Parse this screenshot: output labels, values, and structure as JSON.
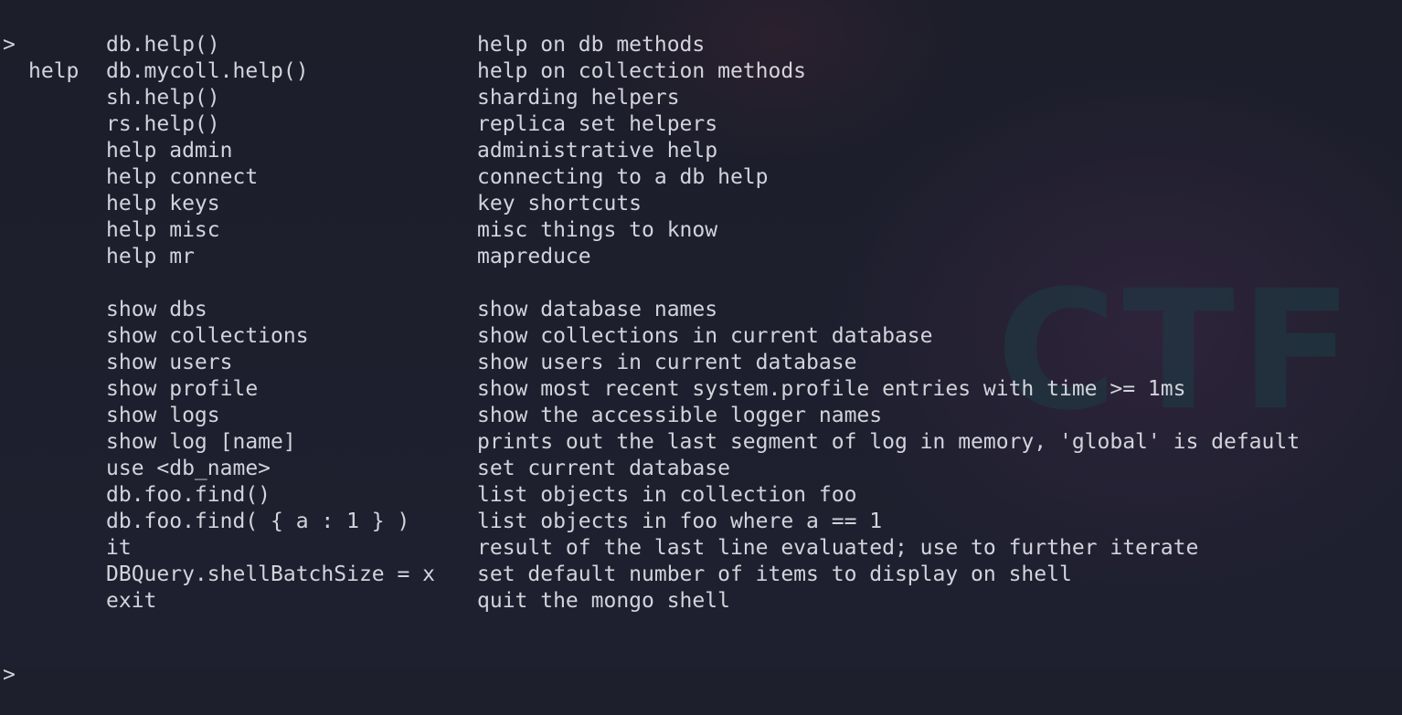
{
  "terminal": {
    "prompt_symbol": ">",
    "entered_command": "help",
    "groups": [
      {
        "rows": [
          {
            "cmd": "db.help()",
            "desc": "help on db methods"
          },
          {
            "cmd": "db.mycoll.help()",
            "desc": "help on collection methods"
          },
          {
            "cmd": "sh.help()",
            "desc": "sharding helpers"
          },
          {
            "cmd": "rs.help()",
            "desc": "replica set helpers"
          },
          {
            "cmd": "help admin",
            "desc": "administrative help"
          },
          {
            "cmd": "help connect",
            "desc": "connecting to a db help"
          },
          {
            "cmd": "help keys",
            "desc": "key shortcuts"
          },
          {
            "cmd": "help misc",
            "desc": "misc things to know"
          },
          {
            "cmd": "help mr",
            "desc": "mapreduce"
          }
        ]
      },
      {
        "rows": [
          {
            "cmd": "show dbs",
            "desc": "show database names"
          },
          {
            "cmd": "show collections",
            "desc": "show collections in current database"
          },
          {
            "cmd": "show users",
            "desc": "show users in current database"
          },
          {
            "cmd": "show profile",
            "desc": "show most recent system.profile entries with time >= 1ms"
          },
          {
            "cmd": "show logs",
            "desc": "show the accessible logger names"
          },
          {
            "cmd": "show log [name]",
            "desc": "prints out the last segment of log in memory, 'global' is default"
          },
          {
            "cmd": "use <db_name>",
            "desc": "set current database"
          },
          {
            "cmd": "db.foo.find()",
            "desc": "list objects in collection foo"
          },
          {
            "cmd": "db.foo.find( { a : 1 } )",
            "desc": "list objects in foo where a == 1"
          },
          {
            "cmd": "it",
            "desc": "result of the last line evaluated; use to further iterate"
          },
          {
            "cmd": "DBQuery.shellBatchSize = x",
            "desc": "set default number of items to display on shell"
          },
          {
            "cmd": "exit",
            "desc": "quit the mongo shell"
          }
        ]
      }
    ],
    "final_prompt": ">"
  },
  "background": {
    "watermark_logo": "CTF",
    "colors": {
      "background": "#1d1f2c",
      "foreground": "#d2d4dc"
    }
  }
}
